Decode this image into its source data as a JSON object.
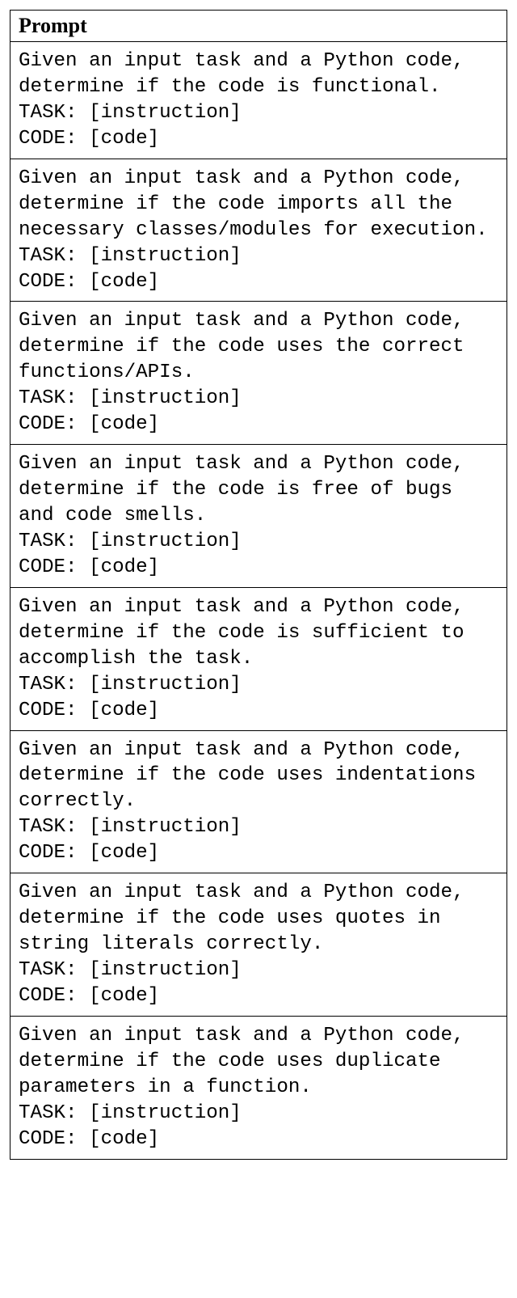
{
  "header": "Prompt",
  "rows": [
    {
      "text": "Given an input task and a Python code, determine if the code is functional.\nTASK: [instruction]\nCODE: [code]"
    },
    {
      "text": "Given an input task and a Python code, determine if the code imports all the necessary classes/modules for execution.\nTASK: [instruction]\nCODE: [code]"
    },
    {
      "text": "Given an input task and a Python code, determine if the code uses the correct functions/APIs.\nTASK: [instruction]\nCODE: [code]"
    },
    {
      "text": "Given an input task and a Python code, determine if the code is free of bugs and code smells.\nTASK: [instruction]\nCODE: [code]"
    },
    {
      "text": "Given an input task and a Python code, determine if the code is sufficient to accomplish the task.\nTASK: [instruction]\nCODE: [code]"
    },
    {
      "text": "Given an input task and a Python code, determine if the code uses indentations correctly.\nTASK: [instruction]\nCODE: [code]"
    },
    {
      "text": "Given an input task and a Python code, determine if the code uses quotes in string literals correctly.\nTASK: [instruction]\nCODE: [code]"
    },
    {
      "text": "Given an input task and a Python code, determine if the code uses duplicate parameters in a function.\nTASK: [instruction]\nCODE: [code]"
    }
  ]
}
